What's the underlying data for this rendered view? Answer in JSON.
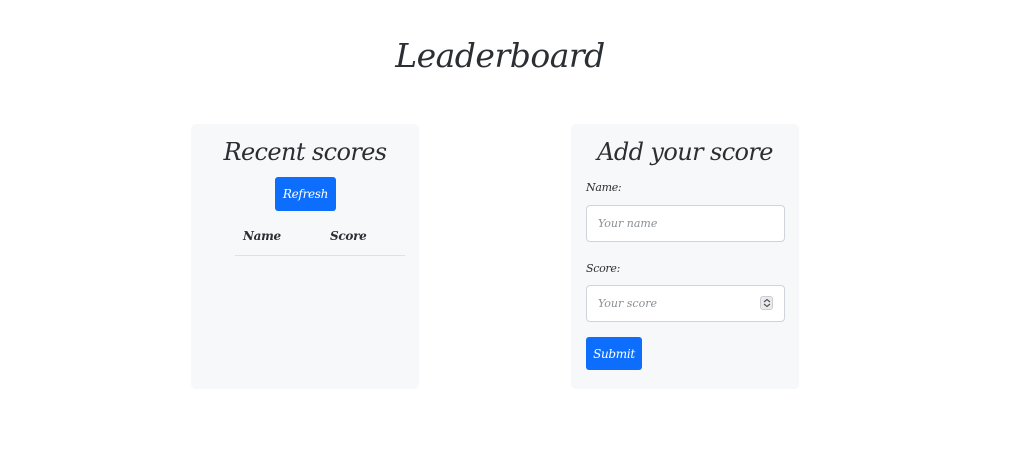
{
  "page": {
    "title": "Leaderboard"
  },
  "recent_scores": {
    "heading": "Recent scores",
    "refresh_label": "Refresh",
    "columns": [
      "Name",
      "Score"
    ],
    "rows": []
  },
  "add_score": {
    "heading": "Add your score",
    "name_label": "Name:",
    "name_placeholder": "Your name",
    "score_label": "Score:",
    "score_placeholder": "Your score",
    "submit_label": "Submit"
  },
  "colors": {
    "primary": "#0d6efd",
    "card_bg": "#f7f8f9",
    "text": "#2b2f33"
  },
  "icons": {
    "score_spinner": "number-spinner-icon"
  }
}
